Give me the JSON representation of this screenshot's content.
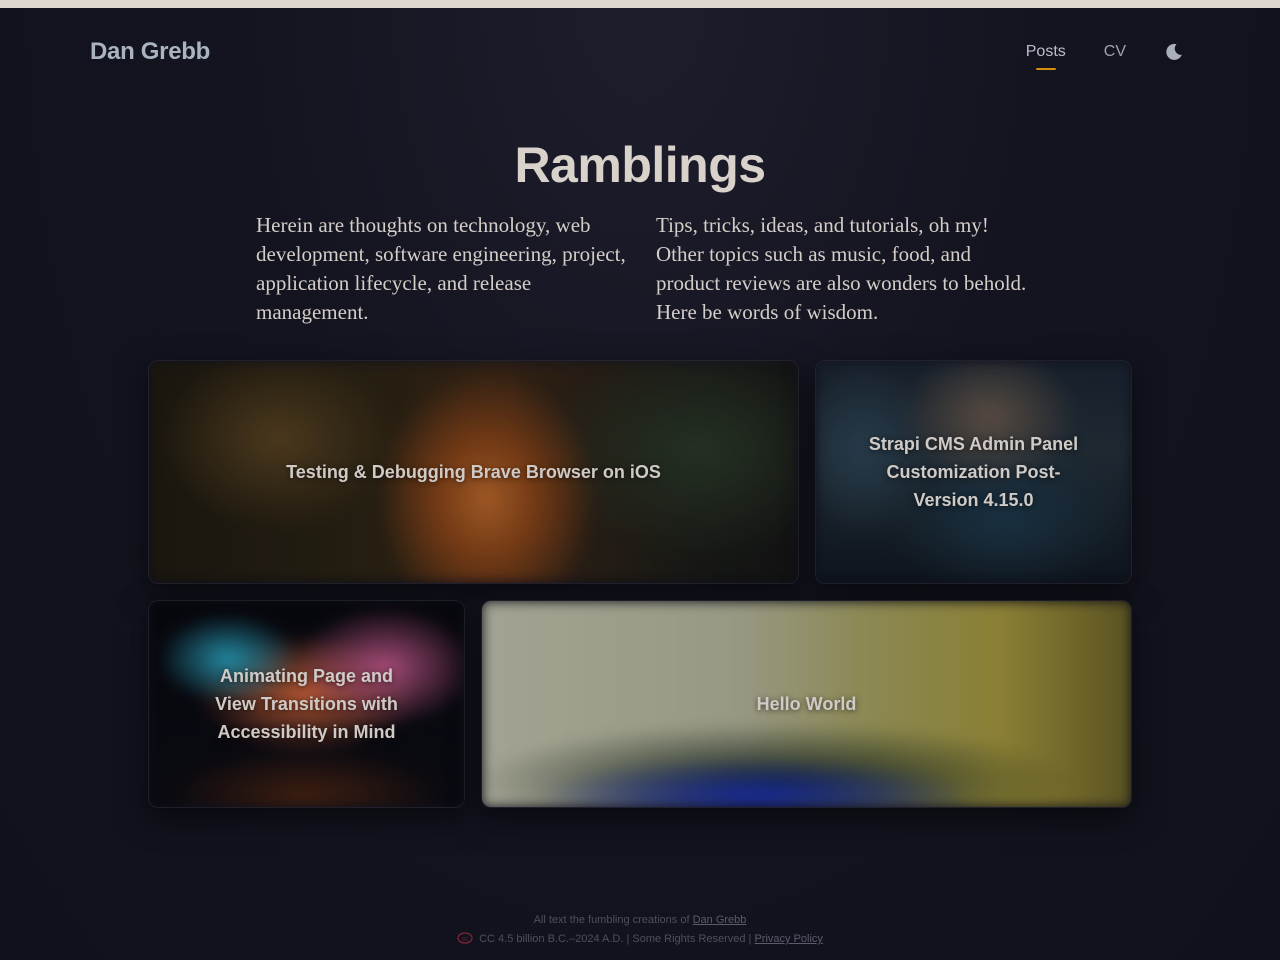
{
  "site": {
    "brand": "Dan Grebb"
  },
  "nav": {
    "items": [
      {
        "label": "Posts",
        "active": true
      },
      {
        "label": "CV",
        "active": false
      }
    ],
    "theme_toggle_icon": "moon-icon"
  },
  "hero": {
    "title": "Ramblings",
    "intro_left": "Herein are thoughts on technology, web development, software engineering, project, application lifecycle, and release management.",
    "intro_right": "Tips, tricks, ideas, and tutorials, oh my! Other topics such as music, food, and product reviews are also wonders to behold. Here be words of wisdom."
  },
  "posts": [
    {
      "title": "Testing & Debugging Brave Browser on iOS"
    },
    {
      "title": "Strapi CMS Admin Panel Customization Post-Version 4.15.0"
    },
    {
      "title": "Animating Page and View Transitions with Accessibility in Mind"
    },
    {
      "title": "Hello World"
    }
  ],
  "footer": {
    "line1_prefix": "All text the fumbling creations of",
    "author_link": "Dan Grebb",
    "license_text": "CC 4.5 billion B.C.–2024 A.D. | Some Rights Reserved |",
    "privacy_link": "Privacy Policy"
  },
  "colors": {
    "accent": "#d4900c",
    "background": "#141420",
    "top_strip": "#ddd6cf"
  }
}
